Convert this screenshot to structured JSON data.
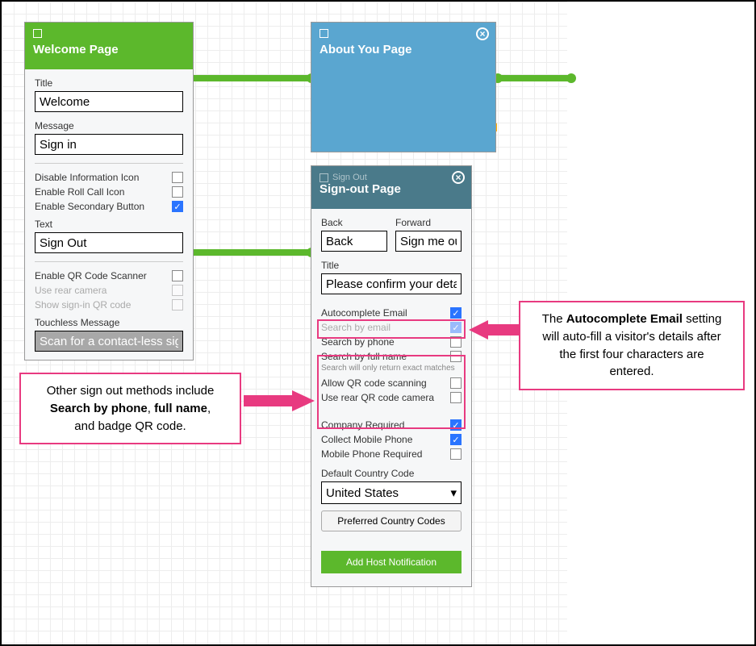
{
  "welcome": {
    "header": "Welcome Page",
    "title_label": "Title",
    "title_value": "Welcome",
    "message_label": "Message",
    "message_value": "Sign in",
    "disable_info": "Disable Information Icon",
    "enable_rollcall": "Enable Roll Call Icon",
    "enable_secondary": "Enable Secondary Button",
    "text_label": "Text",
    "text_value": "Sign Out",
    "enable_qr": "Enable QR Code Scanner",
    "use_rear": "Use rear camera",
    "show_signin_qr": "Show sign-in QR code",
    "touchless_label": "Touchless Message",
    "touchless_value": "Scan for a contact-less sig"
  },
  "about": {
    "header": "About You Page"
  },
  "signout": {
    "tab_label": "Sign Out",
    "header": "Sign-out Page",
    "back_label": "Back",
    "back_value": "Back",
    "forward_label": "Forward",
    "forward_value": "Sign me out",
    "title_label": "Title",
    "title_value": "Please confirm your details",
    "autocomplete_email": "Autocomplete Email",
    "search_email": "Search by email",
    "search_phone": "Search by phone",
    "search_fullname": "Search by full name",
    "search_fullname_sub": "Search will only return exact matches",
    "allow_qr": "Allow QR code scanning",
    "use_rear_qr": "Use rear QR code camera",
    "company_required": "Company Required",
    "collect_mobile": "Collect Mobile Phone",
    "mobile_required": "Mobile Phone Required",
    "default_country_label": "Default Country Code",
    "default_country_value": "United States",
    "preferred_codes_btn": "Preferred Country Codes",
    "add_host_btn": "Add Host Notification"
  },
  "callout_left_l1": "Other sign out methods include",
  "callout_left_l2a": "Search by phone",
  "callout_left_l2b": "full name",
  "callout_left_l3": "and badge QR code.",
  "callout_right_l1a": "The ",
  "callout_right_l1b": "Autocomplete Email",
  "callout_right_l1c": " setting",
  "callout_right_l2": "will auto-fill a visitor's details after",
  "callout_right_l3": "the first four characters are",
  "callout_right_l4": "entered."
}
